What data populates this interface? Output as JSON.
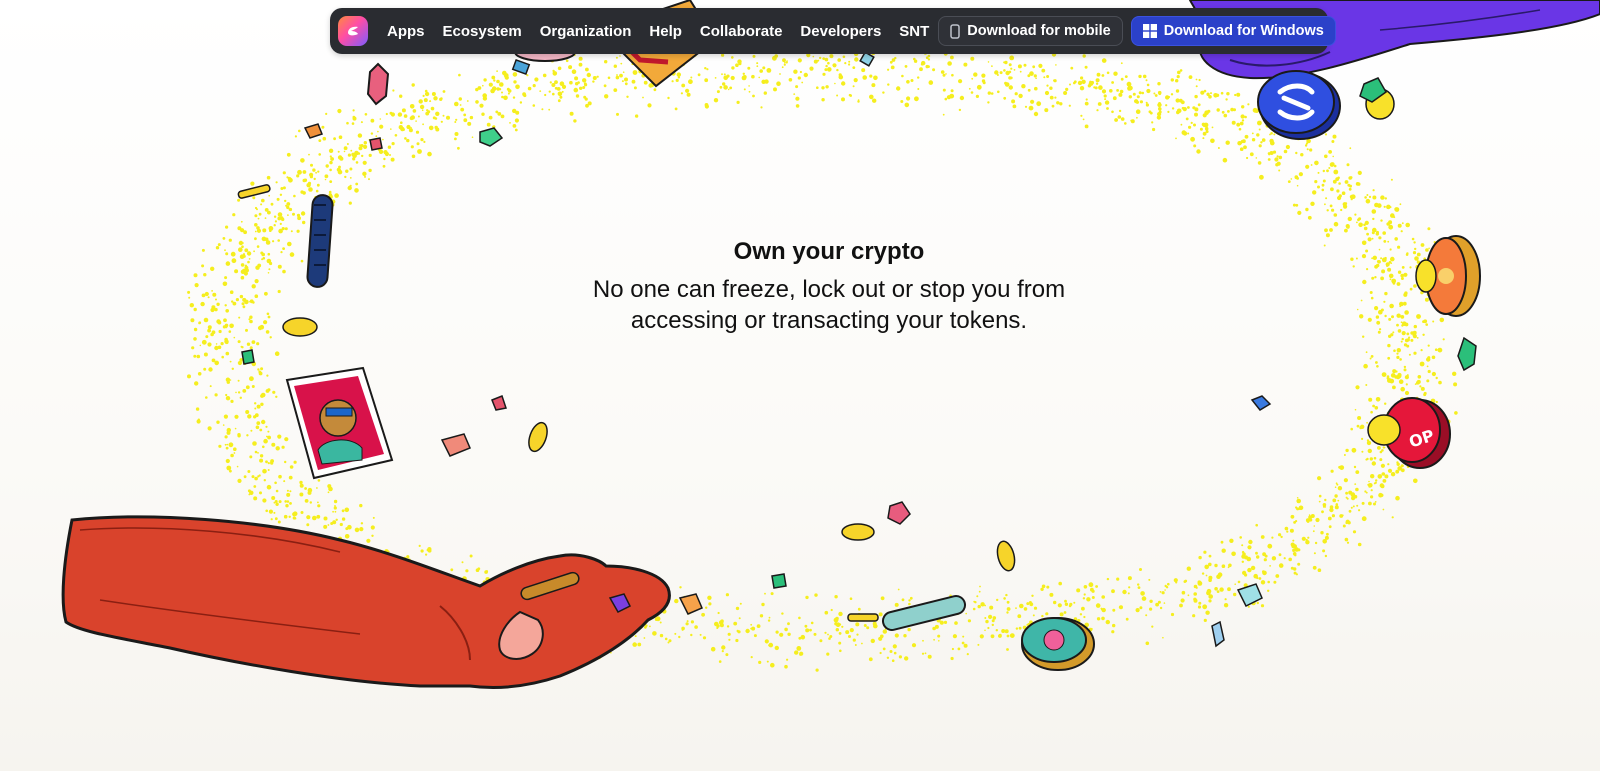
{
  "nav": {
    "logo_icon": "status-logo-icon",
    "links": [
      "Apps",
      "Ecosystem",
      "Organization",
      "Help",
      "Collaborate",
      "Developers",
      "SNT"
    ],
    "download_mobile": "Download for mobile",
    "download_mobile_icon": "phone-icon",
    "download_windows": "Download for Windows",
    "download_windows_icon": "windows-icon"
  },
  "hero": {
    "title": "Own your crypto",
    "subtitle_line1": "No one can freeze, lock out or stop you from",
    "subtitle_line2": "accessing or transacting your tokens."
  },
  "colors": {
    "nav_background": "#2a2c31",
    "windows_button": "#2b41c9",
    "glitter": "#f5ee1e",
    "red_hand": "#d9432c",
    "purple_hand": "#6a36e6"
  }
}
